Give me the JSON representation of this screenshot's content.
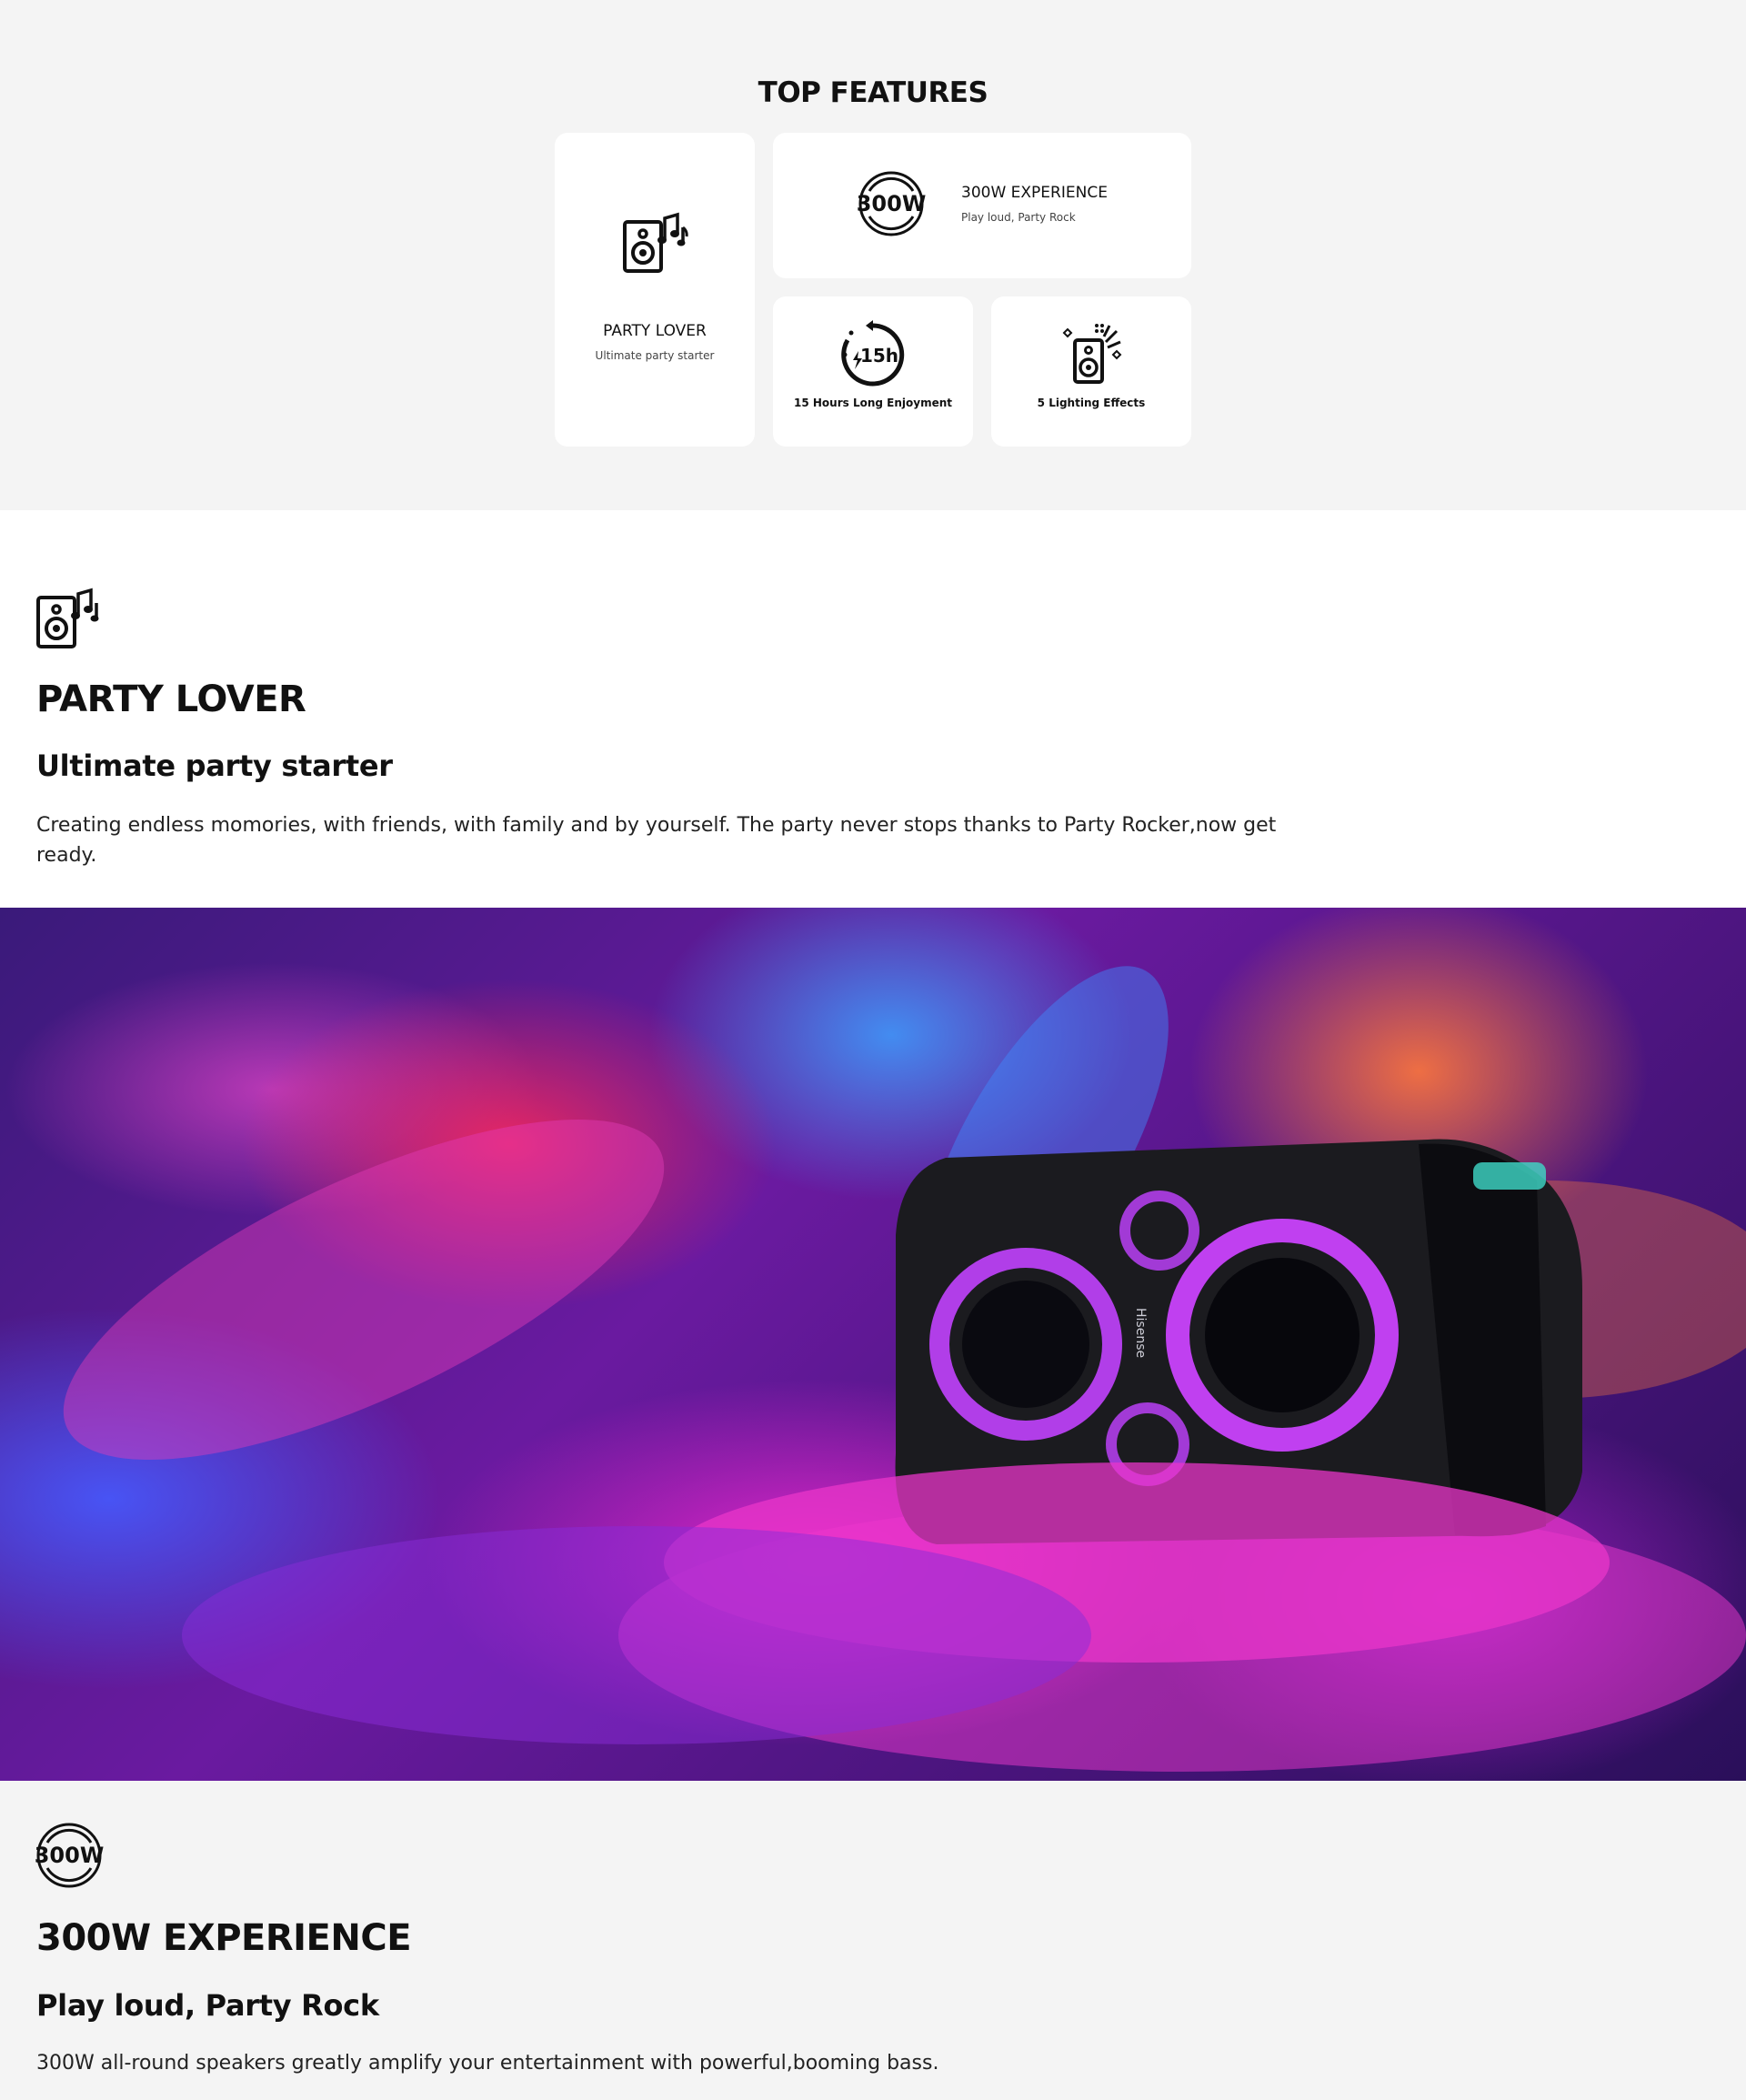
{
  "top_features": {
    "title": "TOP FEATURES",
    "cards": [
      {
        "icon": "speaker-music-icon",
        "title": "PARTY LOVER",
        "subtitle": "Ultimate party starter"
      },
      {
        "icon": "power-300w-icon",
        "title": "300W EXPERIENCE",
        "subtitle": "Play loud, Party Rock"
      },
      {
        "icon": "battery-15h-icon",
        "title": "15 Hours Long Enjoyment",
        "badge": "15h"
      },
      {
        "icon": "lighting-speaker-icon",
        "title": "5 Lighting Effects"
      }
    ],
    "wattage_badge": "300W"
  },
  "section_party": {
    "icon": "speaker-music-icon",
    "title": "PARTY LOVER",
    "subtitle": "Ultimate party starter",
    "description": "Creating endless momories, with friends, with family and by yourself. The party never stops thanks to Party Rocker,now get ready."
  },
  "hero": {
    "brand": "Hisense",
    "image": "party-speaker-color-powder-image"
  },
  "section_300w": {
    "icon": "power-300w-icon",
    "badge": "300W",
    "title": "300W EXPERIENCE",
    "subtitle": "Play loud, Party Rock",
    "description": "300W all-round speakers greatly amplify your entertainment with powerful,booming bass."
  },
  "colors": {
    "page_bg": "#f4f4f4",
    "card_bg": "#ffffff",
    "text": "#111111"
  }
}
